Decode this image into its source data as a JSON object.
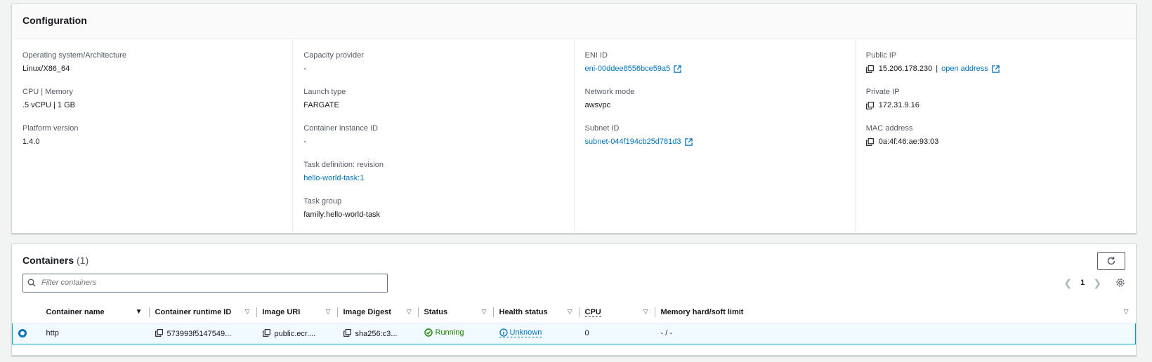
{
  "configuration": {
    "title": "Configuration",
    "col1": [
      {
        "label": "Operating system/Architecture",
        "value": "Linux/X86_64"
      },
      {
        "label": "CPU | Memory",
        "value": ".5 vCPU | 1 GB"
      },
      {
        "label": "Platform version",
        "value": "1.4.0"
      }
    ],
    "col2": [
      {
        "label": "Capacity provider",
        "value": "-"
      },
      {
        "label": "Launch type",
        "value": "FARGATE"
      },
      {
        "label": "Container instance ID",
        "value": "-"
      },
      {
        "label": "Task definition: revision",
        "value": "hello-world-task:1"
      },
      {
        "label": "Task group",
        "value": "family:hello-world-task"
      }
    ],
    "col3": [
      {
        "label": "ENI ID",
        "value": "eni-00ddee8556bce59a5"
      },
      {
        "label": "Network mode",
        "value": "awsvpc"
      },
      {
        "label": "Subnet ID",
        "value": "subnet-044f194cb25d781d3"
      }
    ],
    "col4": {
      "public_ip_label": "Public IP",
      "public_ip": "15.206.178.230",
      "separator": "|",
      "open_address": "open address",
      "private_ip_label": "Private IP",
      "private_ip": "172.31.9.16",
      "mac_label": "MAC address",
      "mac": "0a:4f:46:ae:93:03"
    }
  },
  "containers": {
    "title": "Containers",
    "count": "(1)",
    "filter_placeholder": "Filter containers",
    "page": "1",
    "columns": [
      "Container name",
      "Container runtime ID",
      "Image URI",
      "Image Digest",
      "Status",
      "Health status",
      "CPU",
      "Memory hard/soft limit"
    ],
    "row": {
      "name": "http",
      "runtime_id": "573993f5147549...",
      "image_uri": "public.ecr....",
      "digest": "sha256:c3...",
      "status": "Running",
      "health": "Unknown",
      "cpu": "0",
      "memory": "- / -"
    }
  },
  "colors": {
    "link": "#0073bb",
    "success": "#1d8102",
    "selected_border": "#00a1c9"
  }
}
